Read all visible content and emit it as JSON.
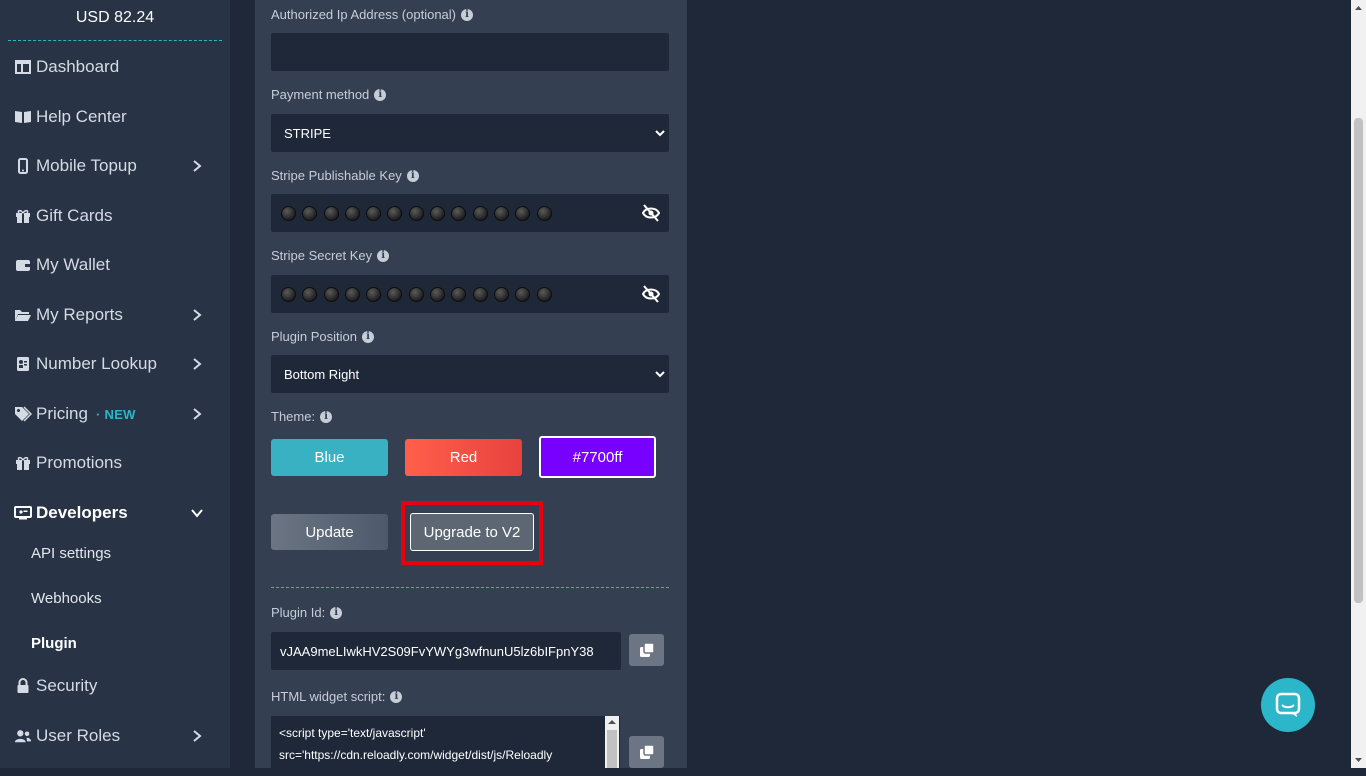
{
  "sidebar": {
    "balance": "USD 82.24",
    "items": [
      {
        "label": "Dashboard"
      },
      {
        "label": "Help Center"
      },
      {
        "label": "Mobile Topup"
      },
      {
        "label": "Gift Cards"
      },
      {
        "label": "My Wallet"
      },
      {
        "label": "My Reports"
      },
      {
        "label": "Number Lookup"
      },
      {
        "label": "Pricing",
        "badge": "· NEW"
      },
      {
        "label": "Promotions"
      },
      {
        "label": "Developers"
      },
      {
        "label": "Security"
      },
      {
        "label": "User Roles"
      }
    ],
    "developers_sub": [
      {
        "label": "API settings"
      },
      {
        "label": "Webhooks"
      },
      {
        "label": "Plugin"
      }
    ]
  },
  "form": {
    "authorized_ip_label": "Authorized Ip Address (optional)",
    "authorized_ip_value": "",
    "payment_method_label": "Payment method",
    "payment_method_value": "STRIPE",
    "stripe_publishable_label": "Stripe Publishable Key",
    "stripe_secret_label": "Stripe Secret Key",
    "plugin_position_label": "Plugin Position",
    "plugin_position_value": "Bottom Right",
    "theme_label": "Theme:",
    "theme_options": [
      "Blue",
      "Red",
      "#7700ff"
    ],
    "theme_colors": {
      "blue": "#3ab0c3",
      "red": "#f25a4a",
      "custom": "#7700ff"
    },
    "update_label": "Update",
    "upgrade_label": "Upgrade to V2",
    "plugin_id_label": "Plugin Id:",
    "plugin_id_value": "vJAA9meLIwkHV2S09FvYWYg3wfnunU5lz6bIFpnY38",
    "html_widget_label": "HTML widget script:",
    "html_widget_line1": "<script type='text/javascript'",
    "html_widget_line2": "src='https://cdn.reloadly.com/widget/dist/js/Reloadly"
  },
  "accent_color": "#2bb6c9",
  "highlight_color": "#e8000e"
}
